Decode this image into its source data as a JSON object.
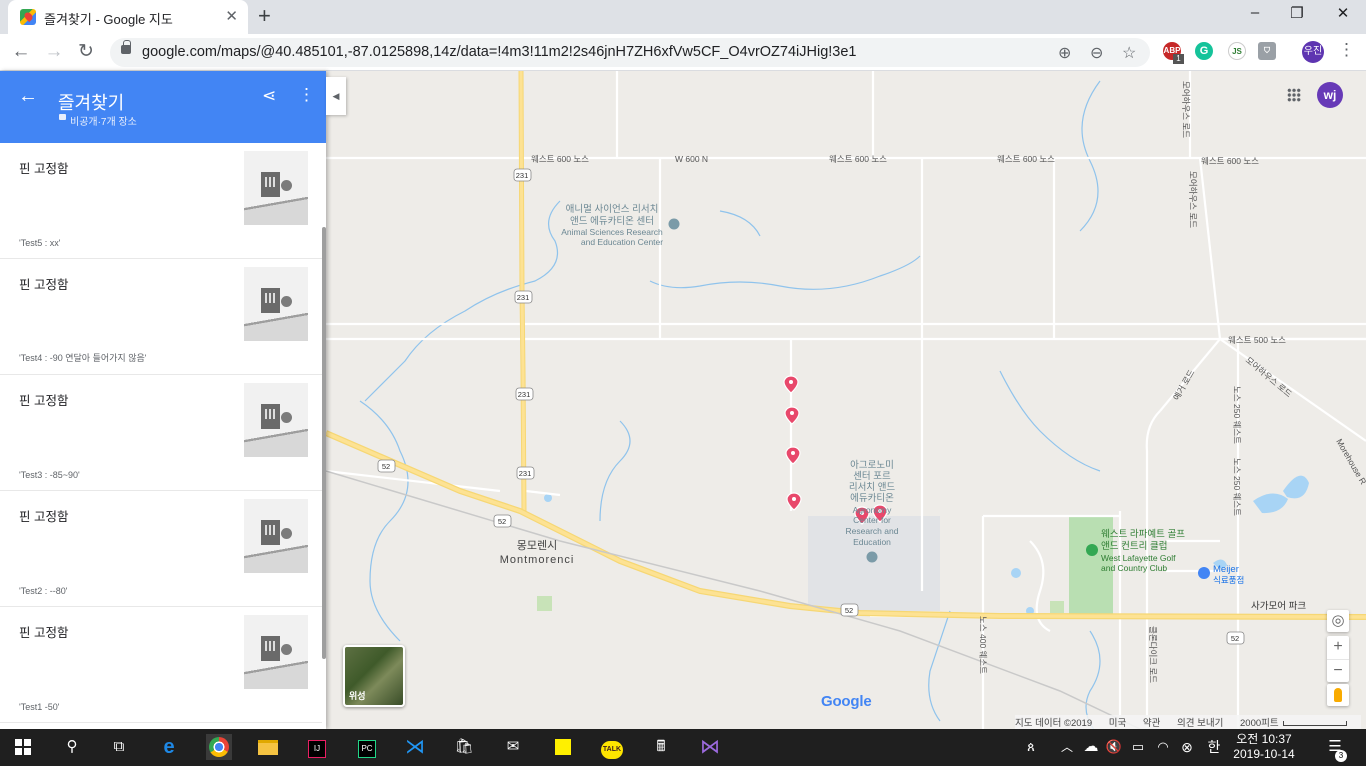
{
  "browser": {
    "tab_title": "즐겨찾기 - Google 지도",
    "url": "google.com/maps/@40.485101,-87.0125898,14z/data=!4m3!11m2!2s46jnH7ZH6xfVw5CF_O4vrOZ74iJHig!3e1",
    "profile_initials": "우진",
    "ext_abp_count": "1"
  },
  "sidebar": {
    "title": "즐겨찾기",
    "subtitle": "비공개·7개 장소",
    "items": [
      {
        "label": "핀 고정함",
        "note": "'Test5 : xx'"
      },
      {
        "label": "핀 고정함",
        "note": "'Test4 : -90 연달아 들어가지 않음'"
      },
      {
        "label": "핀 고정함",
        "note": "'Test3 : -85~90'"
      },
      {
        "label": "핀 고정함",
        "note": "'Test2 : --80'"
      },
      {
        "label": "핀 고정함",
        "note": "'Test1 -50'"
      }
    ]
  },
  "map": {
    "avatar_initials": "wj",
    "satellite_label": "위성",
    "google_logo": "Google",
    "labels": {
      "road_w600n_1": "웨스트 600 노스",
      "road_w600n_2": "W 600 N",
      "road_w600n_3": "웨스트 600 노스",
      "road_w600n_4": "웨스트 600 노스",
      "road_w600n_5": "웨스트 600 노스",
      "road_w500n": "웨스트 500 노스",
      "route_231_a": "231",
      "route_231_b": "231",
      "route_231_c": "231",
      "route_231_d": "231",
      "route_52_a": "52",
      "route_52_b": "52",
      "route_52_c": "52",
      "route_52_d": "52",
      "animal_kr_1": "애니멀 사이언스 리서치",
      "animal_kr_2": "앤드 에듀카티온 센터",
      "animal_en_1": "Animal Sciences Research",
      "animal_en_2": "and Education Center",
      "agro_kr_1": "아그로노미",
      "agro_kr_2": "센터 포르",
      "agro_kr_3": "리서치 앤드",
      "agro_kr_4": "에듀카티온",
      "agro_en_1": "Agronomy",
      "agro_en_2": "Center for",
      "agro_en_3": "Research and",
      "agro_en_4": "Education",
      "town_kr": "몽모렌시",
      "town_en": "Montmorenci",
      "golf_kr_1": "웨스트 라파예트 골프",
      "golf_kr_2": "앤드 컨트리 클럽",
      "golf_en_1": "West Lafayette Golf",
      "golf_en_2": "and Country Club",
      "meijer_1": "Meijer",
      "meijer_2": "식료품점",
      "road_sagamore": "사가모어 파크",
      "road_morehouse": "모어하우스 로드",
      "road_morehouse_en": "Morehouse R",
      "road_morehouse_2": "모어하우스 로드",
      "road_n250w": "노스 250 웨스트",
      "road_n250w_2": "노스 250 웨스트",
      "road_n400w": "노스 400 웨스트",
      "road_klondike": "클론다이크 로드",
      "road_yeager": "예거 로드",
      "road_morehouse_top": "모어하우스 로드"
    },
    "attribution": [
      "지도 데이터 ©2019",
      "미국",
      "약관",
      "의견 보내기",
      "2000피트"
    ]
  },
  "taskbar": {
    "clock_ampm_time": "오전 10:37",
    "clock_date": "2019-10-14",
    "ime": "한",
    "notif_count": "3"
  }
}
